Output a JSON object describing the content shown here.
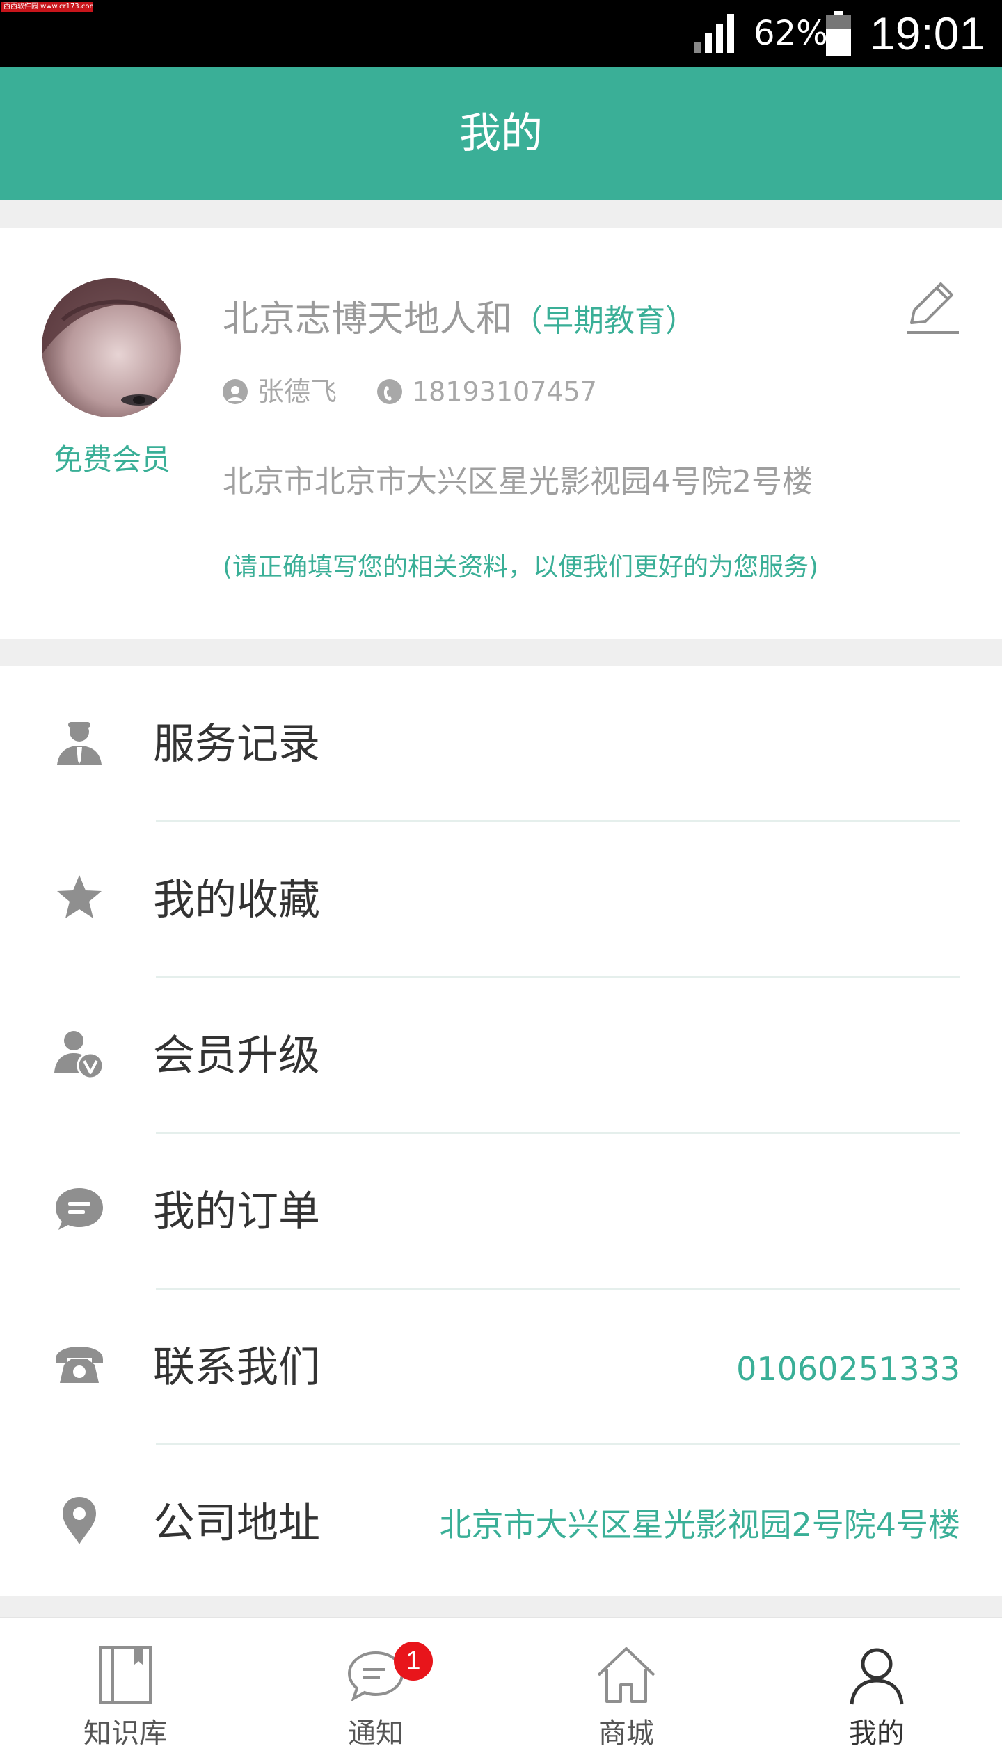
{
  "status_bar": {
    "watermark": "西西软件园 www.cr173.com",
    "battery_percent": "62%",
    "time": "19:01",
    "signal_icon": "signal-bars-icon",
    "battery_icon": "battery-icon"
  },
  "header": {
    "title": "我的"
  },
  "profile": {
    "organization": "北京志博天地人和",
    "organization_type": "（早期教育）",
    "member_level": "免费会员",
    "contact_name": "张德飞",
    "phone": "18193107457",
    "address": "北京市北京市大兴区星光影视园4号院2号楼",
    "hint": "(请正确填写您的相关资料，以便我们更好的为您服务)",
    "edit_icon": "edit-pencil-icon",
    "avatar_icon": "user-avatar-photo"
  },
  "menu": {
    "items": [
      {
        "label": "服务记录",
        "icon": "service-person-icon",
        "value": ""
      },
      {
        "label": "我的收藏",
        "icon": "star-icon",
        "value": ""
      },
      {
        "label": "会员升级",
        "icon": "member-v-icon",
        "value": ""
      },
      {
        "label": "我的订单",
        "icon": "chat-bubble-icon",
        "value": ""
      },
      {
        "label": "联系我们",
        "icon": "phone-icon",
        "value": "01060251333"
      },
      {
        "label": "公司地址",
        "icon": "location-pin-icon",
        "value": "北京市大兴区星光影视园2号院4号楼"
      }
    ]
  },
  "tabs": {
    "items": [
      {
        "label": "知识库",
        "icon": "book-icon",
        "active": false
      },
      {
        "label": "通知",
        "icon": "chat-notification-icon",
        "active": false,
        "badge": "1"
      },
      {
        "label": "商城",
        "icon": "house-icon",
        "active": false
      },
      {
        "label": "我的",
        "icon": "user-outline-icon",
        "active": true
      }
    ]
  },
  "colors": {
    "accent": "#3aaf97",
    "badge": "#e8151b",
    "icon_gray": "#8f8f8f"
  }
}
